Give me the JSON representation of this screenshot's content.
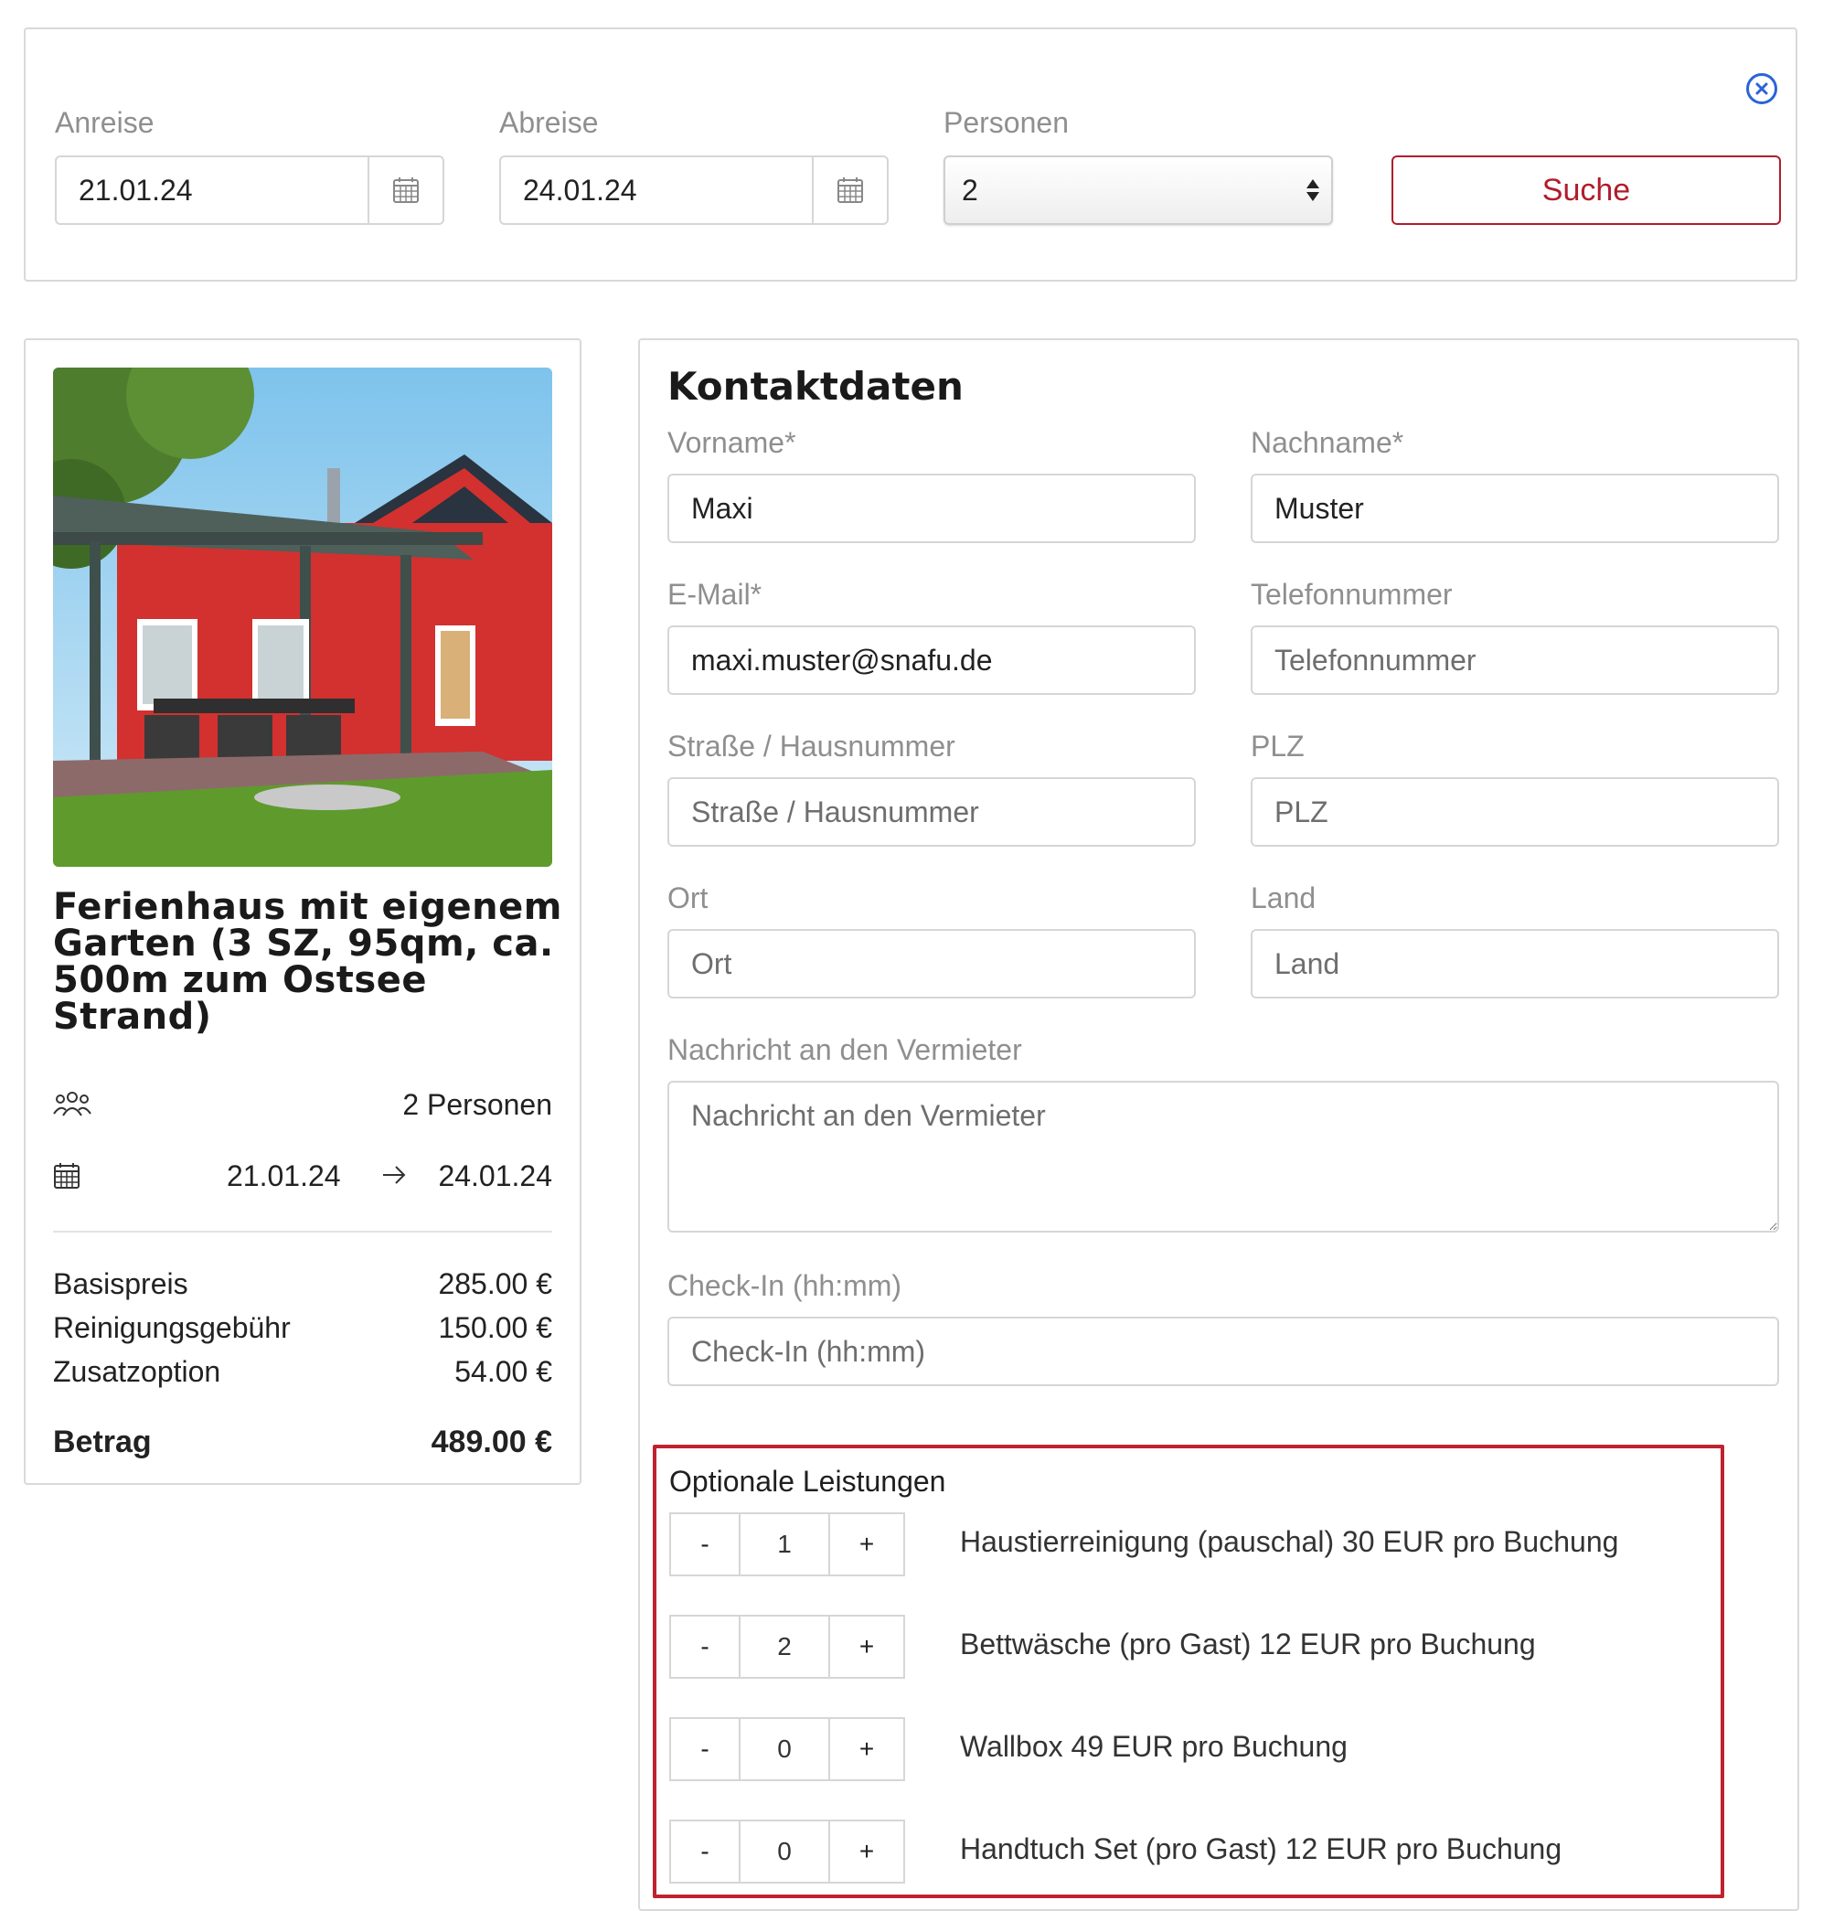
{
  "search": {
    "arrival_label": "Anreise",
    "arrival_value": "21.01.24",
    "departure_label": "Abreise",
    "departure_value": "24.01.24",
    "persons_label": "Personen",
    "persons_value": "2",
    "search_button": "Suche"
  },
  "property": {
    "title": "Ferienhaus mit eigenem Garten (3 SZ, 95qm, ca. 500m zum Ostsee Strand)",
    "persons": "2 Personen",
    "date_from": "21.01.24",
    "date_to": "24.01.24",
    "prices": [
      {
        "label": "Basispreis",
        "value": "285.00 €"
      },
      {
        "label": "Reinigungsgebühr",
        "value": "150.00 €"
      },
      {
        "label": "Zusatzoption",
        "value": "54.00 €"
      }
    ],
    "total_label": "Betrag",
    "total_value": "489.00 €"
  },
  "contact": {
    "title": "Kontaktdaten",
    "firstname_label": "Vorname*",
    "firstname_value": "Maxi",
    "lastname_label": "Nachname*",
    "lastname_value": "Muster",
    "email_label": "E-Mail*",
    "email_value": "maxi.muster@snafu.de",
    "phone_label": "Telefonnummer",
    "phone_placeholder": "Telefonnummer",
    "street_label": "Straße / Hausnummer",
    "street_placeholder": "Straße / Hausnummer",
    "zip_label": "PLZ",
    "zip_placeholder": "PLZ",
    "city_label": "Ort",
    "city_placeholder": "Ort",
    "country_label": "Land",
    "country_placeholder": "Land",
    "message_label": "Nachricht an den Vermieter",
    "message_placeholder": "Nachricht an den Vermieter",
    "checkin_label": "Check-In (hh:mm)",
    "checkin_placeholder": "Check-In (hh:mm)"
  },
  "options": {
    "title": "Optionale Leistungen",
    "minus": "-",
    "plus": "+",
    "items": [
      {
        "qty": "1",
        "label": "Haustierreinigung (pauschal) 30 EUR pro Buchung"
      },
      {
        "qty": "2",
        "label": "Bettwäsche (pro Gast) 12 EUR pro Buchung"
      },
      {
        "qty": "0",
        "label": "Wallbox 49 EUR pro Buchung"
      },
      {
        "qty": "0",
        "label": "Handtuch Set (pro Gast) 12 EUR pro Buchung"
      }
    ]
  },
  "colors": {
    "accent_red": "#b01d2b",
    "highlight_border": "#c0222e",
    "close_icon_blue": "#2b63d9",
    "house_red": "#d2312f"
  }
}
